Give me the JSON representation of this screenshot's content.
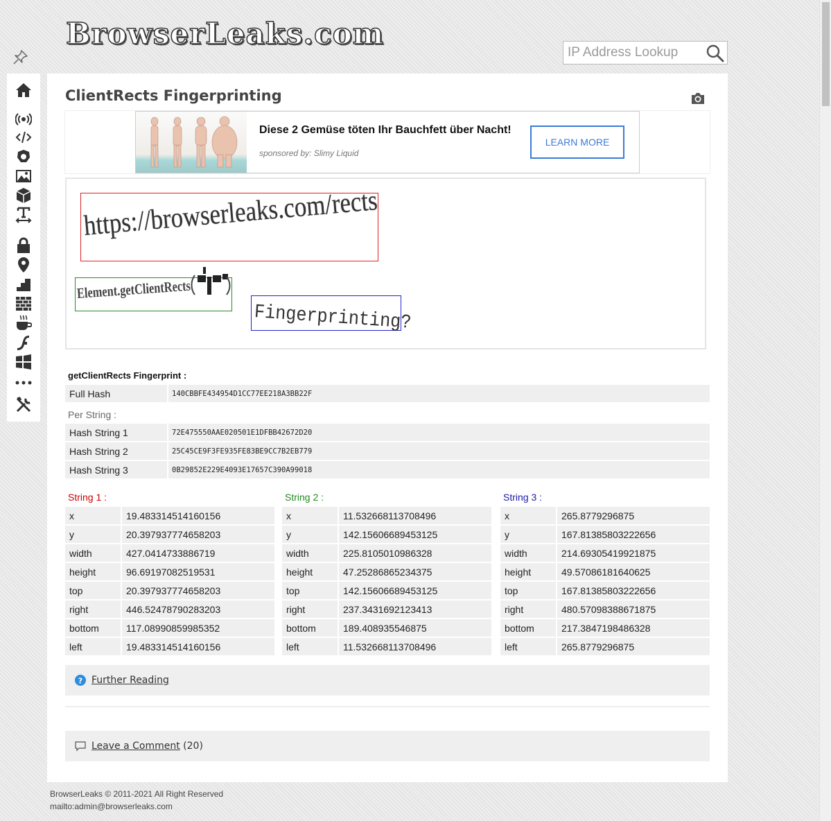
{
  "header": {
    "logo_text": "BrowserLeaks.com",
    "search_placeholder": "IP Address Lookup"
  },
  "sidebar": {
    "items": [
      "home-icon",
      "broadcast-icon",
      "code-icon",
      "gear-shield-icon",
      "image-icon",
      "cube-icon",
      "text-width-icon",
      "lock-icon",
      "map-pin-icon",
      "steps-icon",
      "brick-wall-icon",
      "java-cup-icon",
      "flash-icon",
      "windows-icon",
      "more-icon",
      "tools-icon"
    ]
  },
  "page": {
    "title": "ClientRects Fingerprinting"
  },
  "ad": {
    "headline": "Diese 2 Gemüse töten Ihr Bauchfett über Nacht!",
    "sponsor": "sponsored by: Slimy Liquid",
    "button": "LEARN MORE"
  },
  "canvas": {
    "string1": "https://browserleaks.com/rects",
    "string2": "Element.getClientRects",
    "string3": "Fingerprinting?"
  },
  "fingerprint": {
    "label": "getClientRects Fingerprint :",
    "full_hash_label": "Full Hash",
    "full_hash": "140CBBFE434954D1CC77EE218A3BB22F",
    "per_string_label": "Per String :",
    "hashes": [
      {
        "label": "Hash String 1",
        "value": "72E475550AAE020501E1DFBB42672D20"
      },
      {
        "label": "Hash String 2",
        "value": "25C45CE9F3FE935FE83BE9CC7B2EB779"
      },
      {
        "label": "Hash String 3",
        "value": "0B29852E229E4093E17657C390A99018"
      }
    ]
  },
  "strings": [
    {
      "heading": "String 1 :",
      "color": "#cc0000",
      "rows": [
        {
          "k": "x",
          "v": "19.483314514160156"
        },
        {
          "k": "y",
          "v": "20.397937774658203"
        },
        {
          "k": "width",
          "v": "427.0414733886719"
        },
        {
          "k": "height",
          "v": "96.69197082519531"
        },
        {
          "k": "top",
          "v": "20.397937774658203"
        },
        {
          "k": "right",
          "v": "446.52478790283203"
        },
        {
          "k": "bottom",
          "v": "117.08990859985352"
        },
        {
          "k": "left",
          "v": "19.483314514160156"
        }
      ]
    },
    {
      "heading": "String 2 :",
      "color": "#228b22",
      "rows": [
        {
          "k": "x",
          "v": "11.532668113708496"
        },
        {
          "k": "y",
          "v": "142.15606689453125"
        },
        {
          "k": "width",
          "v": "225.8105010986328"
        },
        {
          "k": "height",
          "v": "47.25286865234375"
        },
        {
          "k": "top",
          "v": "142.15606689453125"
        },
        {
          "k": "right",
          "v": "237.3431692123413"
        },
        {
          "k": "bottom",
          "v": "189.408935546875"
        },
        {
          "k": "left",
          "v": "11.532668113708496"
        }
      ]
    },
    {
      "heading": "String 3 :",
      "color": "#1a1aaa",
      "rows": [
        {
          "k": "x",
          "v": "265.8779296875"
        },
        {
          "k": "y",
          "v": "167.81385803222656"
        },
        {
          "k": "width",
          "v": "214.69305419921875"
        },
        {
          "k": "height",
          "v": "49.57086181640625"
        },
        {
          "k": "top",
          "v": "167.81385803222656"
        },
        {
          "k": "right",
          "v": "480.57098388671875"
        },
        {
          "k": "bottom",
          "v": "217.3847198486328"
        },
        {
          "k": "left",
          "v": "265.8779296875"
        }
      ]
    }
  ],
  "further_reading": "Further Reading",
  "comments": {
    "link": "Leave a Comment",
    "count": "(20)"
  },
  "footer": {
    "copyright": "BrowserLeaks © 2011-2021 All Right Reserved",
    "mail": "mailto:admin@browserleaks.com"
  }
}
